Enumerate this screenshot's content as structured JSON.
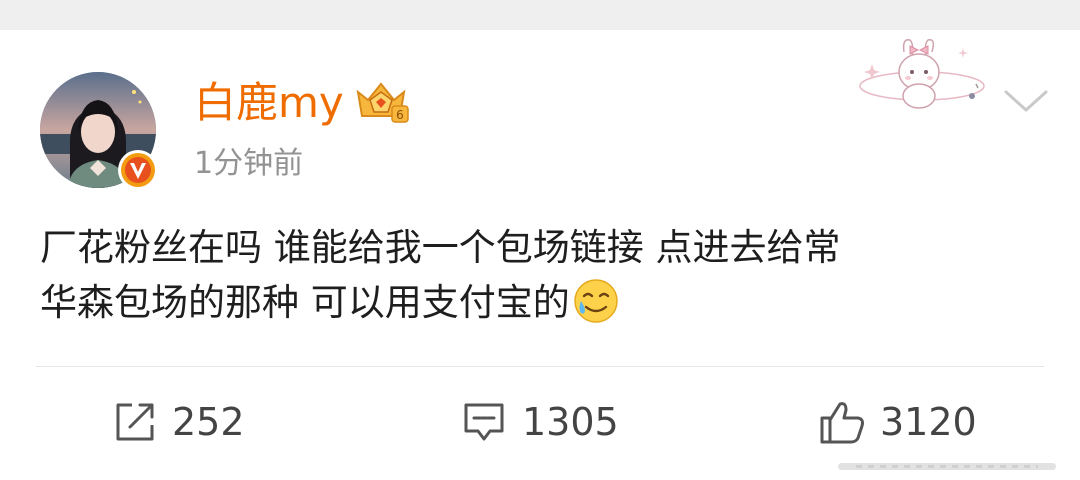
{
  "post": {
    "author": {
      "name": "白鹿my",
      "verified": true,
      "avatar_icon": "avatar-photo",
      "badge_icon": "verified-v-icon",
      "vip_icon": "vip-crown-icon"
    },
    "timestamp": "1分钟前",
    "text_lines": [
      "厂花粉丝在吗 谁能给我一个包场链接 点进去给常",
      "华森包场的那种 可以用支付宝的"
    ],
    "trailing_emoji": "tearful-smile-emoji",
    "menu_icon": "chevron-down-icon",
    "decoration_icon": "bunny-sticker-icon"
  },
  "actions": {
    "share": {
      "icon": "share-icon",
      "count": "252"
    },
    "comment": {
      "icon": "comment-icon",
      "count": "1305"
    },
    "like": {
      "icon": "thumbs-up-icon",
      "count": "3120"
    }
  },
  "colors": {
    "username": "#ef6c00",
    "badge": "#f39c12",
    "muted": "#939393",
    "text": "#1e1e1e",
    "background": "#efefef"
  }
}
